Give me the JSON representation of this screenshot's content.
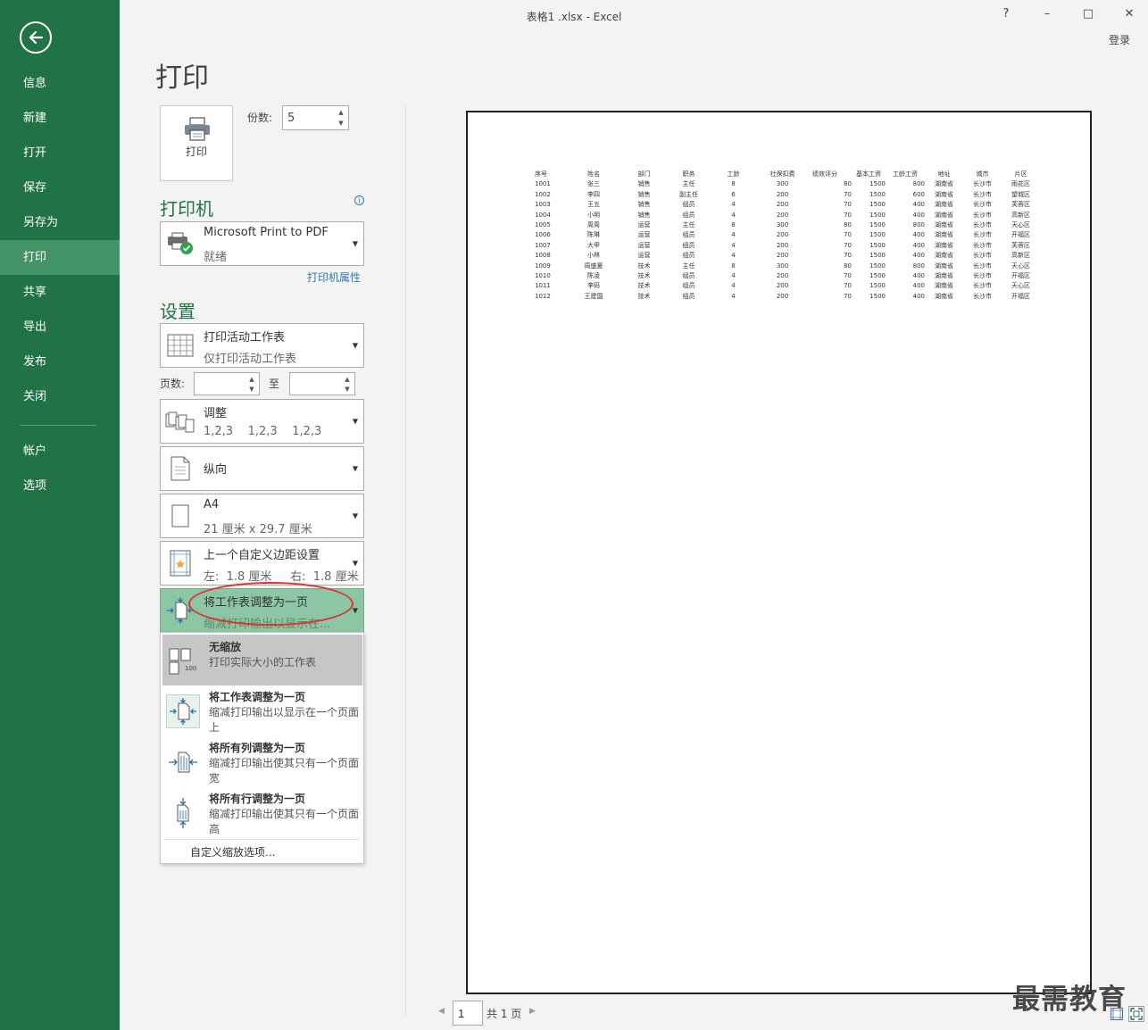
{
  "window": {
    "title": "表格1 .xlsx - Excel",
    "help": "?",
    "minimize": "–",
    "maximize": "□",
    "close": "✕",
    "login": "登录"
  },
  "sidebar": {
    "items": [
      {
        "label": "信息"
      },
      {
        "label": "新建"
      },
      {
        "label": "打开"
      },
      {
        "label": "保存"
      },
      {
        "label": "另存为"
      },
      {
        "label": "打印"
      },
      {
        "label": "共享"
      },
      {
        "label": "导出"
      },
      {
        "label": "发布"
      },
      {
        "label": "关闭"
      },
      {
        "label": "帐户"
      },
      {
        "label": "选项"
      }
    ],
    "active": "打印"
  },
  "print": {
    "heading": "打印",
    "button_label": "打印",
    "copies_label": "份数:",
    "copies_value": "5"
  },
  "printer": {
    "section_title": "打印机",
    "name": "Microsoft Print to PDF",
    "status": "就绪",
    "properties_link": "打印机属性"
  },
  "settings": {
    "section_title": "设置",
    "print_what": {
      "title": "打印活动工作表",
      "subtitle": "仅打印活动工作表"
    },
    "pages_label": "页数:",
    "pages_to_label": "至",
    "collate": {
      "title": "调整",
      "subtitle": "1,2,3    1,2,3    1,2,3"
    },
    "orientation": {
      "title": "纵向"
    },
    "paper": {
      "title": "A4",
      "subtitle": "21 厘米 x 29.7 厘米"
    },
    "margins": {
      "title": "上一个自定义边距设置",
      "subtitle": "左:  1.8 厘米     右:  1.8 厘米"
    },
    "scaling": {
      "title": "将工作表调整为一页",
      "subtitle": "缩减打印输出以显示在..."
    }
  },
  "scaling_menu": {
    "items": [
      {
        "title": "无缩放",
        "desc": "打印实际大小的工作表",
        "icon_text": "100"
      },
      {
        "title": "将工作表调整为一页",
        "desc": "缩减打印输出以显示在一个页面上"
      },
      {
        "title": "将所有列调整为一页",
        "desc": "缩减打印输出使其只有一个页面宽"
      },
      {
        "title": "将所有行调整为一页",
        "desc": "缩减打印输出使其只有一个页面高"
      }
    ],
    "custom": "自定义缩放选项..."
  },
  "preview": {
    "headers": [
      "序号",
      "姓名",
      "部门",
      "职务",
      "工龄",
      "社保扣费",
      "绩效评分",
      "基本工资",
      "工龄工资",
      "地址",
      "城市",
      "片区"
    ],
    "rows": [
      [
        "1001",
        "张三",
        "销售",
        "主任",
        "8",
        "300",
        "80",
        "1500",
        "800",
        "湖南省",
        "长沙市",
        "雨花区"
      ],
      [
        "1002",
        "李四",
        "销售",
        "副主任",
        "6",
        "200",
        "70",
        "1500",
        "600",
        "湖南省",
        "长沙市",
        "望城区"
      ],
      [
        "1003",
        "王五",
        "销售",
        "组员",
        "4",
        "200",
        "70",
        "1500",
        "400",
        "湖南省",
        "长沙市",
        "芙蓉区"
      ],
      [
        "1004",
        "小明",
        "销售",
        "组员",
        "4",
        "200",
        "70",
        "1500",
        "400",
        "湖南省",
        "长沙市",
        "高新区"
      ],
      [
        "1005",
        "周周",
        "运营",
        "主任",
        "8",
        "300",
        "80",
        "1500",
        "800",
        "湖南省",
        "长沙市",
        "天心区"
      ],
      [
        "1006",
        "陈琳",
        "运营",
        "组员",
        "4",
        "200",
        "70",
        "1500",
        "400",
        "湖南省",
        "长沙市",
        "开福区"
      ],
      [
        "1007",
        "大甲",
        "运营",
        "组员",
        "4",
        "200",
        "70",
        "1500",
        "400",
        "湖南省",
        "长沙市",
        "芙蓉区"
      ],
      [
        "1008",
        "小林",
        "运营",
        "组员",
        "4",
        "200",
        "70",
        "1500",
        "400",
        "湖南省",
        "长沙市",
        "高新区"
      ],
      [
        "1009",
        "周盛夏",
        "技术",
        "主任",
        "8",
        "300",
        "80",
        "1500",
        "800",
        "湖南省",
        "长沙市",
        "天心区"
      ],
      [
        "1010",
        "陈凌",
        "技术",
        "组员",
        "4",
        "200",
        "70",
        "1500",
        "400",
        "湖南省",
        "长沙市",
        "开福区"
      ],
      [
        "1011",
        "李码",
        "技术",
        "组员",
        "4",
        "200",
        "70",
        "1500",
        "400",
        "湖南省",
        "长沙市",
        "天心区"
      ],
      [
        "1012",
        "王建国",
        "技术",
        "组员",
        "4",
        "200",
        "70",
        "1500",
        "400",
        "湖南省",
        "长沙市",
        "开福区"
      ]
    ],
    "current_page": "1",
    "total_pages": "共 1 页"
  },
  "watermark": "最需教育",
  "colors": {
    "sidebar": "#217346",
    "sidebar_active": "#439467",
    "accent_text": "#217346",
    "link": "#2b79c2",
    "highlight_fill": "#8cc6a5",
    "annotation": "#e03030"
  }
}
